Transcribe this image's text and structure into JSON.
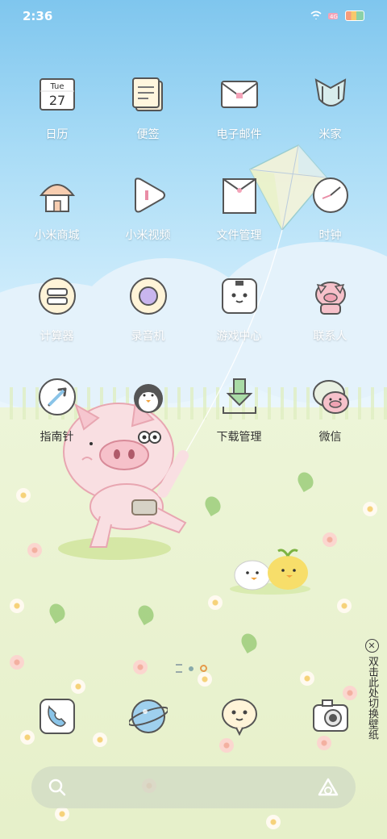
{
  "status_bar": {
    "time": "2:36",
    "icons": [
      "wifi-icon",
      "signal-icon",
      "battery-icon"
    ]
  },
  "apps": [
    {
      "id": "calendar",
      "label": "日历",
      "icon": "calendar-icon",
      "calendar": {
        "weekday": "Tue",
        "day": "27"
      }
    },
    {
      "id": "notes",
      "label": "便签",
      "icon": "notes-icon"
    },
    {
      "id": "email",
      "label": "电子邮件",
      "icon": "envelope-icon"
    },
    {
      "id": "mijia",
      "label": "米家",
      "icon": "mijia-icon"
    },
    {
      "id": "mi-store",
      "label": "小米商城",
      "icon": "house-icon"
    },
    {
      "id": "mi-video",
      "label": "小米视频",
      "icon": "play-icon"
    },
    {
      "id": "file-manager",
      "label": "文件管理",
      "icon": "folder-icon"
    },
    {
      "id": "clock",
      "label": "时钟",
      "icon": "clock-icon"
    },
    {
      "id": "calculator",
      "label": "计算器",
      "icon": "calculator-icon"
    },
    {
      "id": "recorder",
      "label": "录音机",
      "icon": "recorder-icon"
    },
    {
      "id": "game-center",
      "label": "游戏中心",
      "icon": "game-center-icon"
    },
    {
      "id": "contacts",
      "label": "联系人",
      "icon": "pig-contact-icon"
    },
    {
      "id": "compass",
      "label": "指南针",
      "icon": "compass-icon"
    },
    {
      "id": "security",
      "label": "",
      "icon": "penguin-icon"
    },
    {
      "id": "downloads",
      "label": "下载管理",
      "icon": "download-icon"
    },
    {
      "id": "wechat",
      "label": "微信",
      "icon": "chat-pig-icon"
    }
  ],
  "dock": [
    {
      "id": "phone",
      "icon": "phone-icon"
    },
    {
      "id": "browser",
      "icon": "globe-icon"
    },
    {
      "id": "messages",
      "icon": "message-bubble-icon"
    },
    {
      "id": "camera",
      "icon": "camera-icon"
    }
  ],
  "page_indicator": {
    "pages": 2,
    "active": 2
  },
  "wallpaper_tip": {
    "text": "双击此处切换壁纸",
    "close_icon": "close-circle-icon"
  },
  "colors": {
    "sky": "#7fc6ee",
    "grass": "#eaf2cf",
    "pig": "#f7d3d6",
    "accent": "#e59b4b"
  }
}
